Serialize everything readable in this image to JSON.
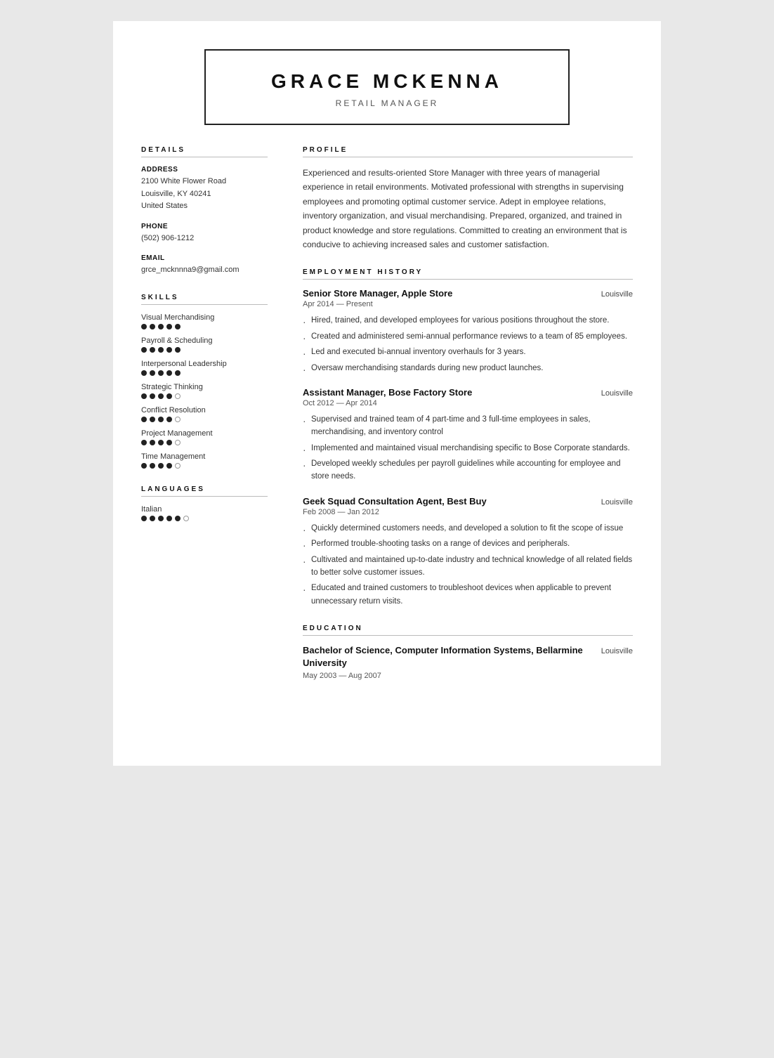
{
  "header": {
    "name": "GRACE MCKENNA",
    "title": "RETAIL MANAGER"
  },
  "details": {
    "section_title": "DETAILS",
    "address_label": "ADDRESS",
    "address_lines": [
      "2100 White Flower Road",
      "Louisville, KY 40241",
      "United States"
    ],
    "phone_label": "PHONE",
    "phone": "(502) 906-1212",
    "email_label": "EMAIL",
    "email": "grce_mcknnna9@gmail.com"
  },
  "skills": {
    "section_title": "SKILLS",
    "items": [
      {
        "name": "Visual Merchandising",
        "filled": 5,
        "empty": 0
      },
      {
        "name": "Payroll & Scheduling",
        "filled": 5,
        "empty": 0
      },
      {
        "name": "Interpersonal Leadership",
        "filled": 5,
        "empty": 0
      },
      {
        "name": "Strategic Thinking",
        "filled": 4,
        "empty": 1
      },
      {
        "name": "Conflict Resolution",
        "filled": 4,
        "empty": 1
      },
      {
        "name": "Project Management",
        "filled": 4,
        "empty": 1
      },
      {
        "name": "Time Management",
        "filled": 4,
        "empty": 1
      }
    ]
  },
  "languages": {
    "section_title": "LANGUAGES",
    "items": [
      {
        "name": "Italian",
        "filled": 5,
        "empty": 1
      }
    ]
  },
  "profile": {
    "section_title": "PROFILE",
    "text": "Experienced and results-oriented Store Manager with three years of managerial experience in retail environments. Motivated professional with strengths in supervising employees and promoting optimal customer service. Adept in employee relations, inventory organization, and visual merchandising. Prepared, organized, and trained in product knowledge and store regulations. Committed to creating an environment that is conducive to achieving increased sales and customer satisfaction."
  },
  "employment": {
    "section_title": "EMPLOYMENT HISTORY",
    "jobs": [
      {
        "title": "Senior Store Manager, Apple Store",
        "location": "Louisville",
        "date": "Apr 2014 — Present",
        "bullets": [
          "Hired, trained, and developed employees for various positions throughout the store.",
          "Created and administered semi-annual performance reviews to a team of 85 employees.",
          "Led and executed bi-annual inventory overhauls for 3 years.",
          "Oversaw merchandising standards during new product launches."
        ]
      },
      {
        "title": "Assistant Manager, Bose Factory Store",
        "location": "Louisville",
        "date": "Oct 2012 — Apr 2014",
        "bullets": [
          "Supervised and trained team of 4 part-time and 3 full-time employees in sales, merchandising, and inventory control",
          "Implemented and maintained visual merchandising specific to Bose Corporate standards.",
          "Developed weekly schedules per payroll guidelines while accounting for employee and store needs."
        ]
      },
      {
        "title": "Geek Squad Consultation Agent, Best Buy",
        "location": "Louisville",
        "date": "Feb 2008 — Jan 2012",
        "bullets": [
          "Quickly determined customers needs, and developed a solution to fit the scope of issue",
          "Performed trouble-shooting tasks on a range of devices and peripherals.",
          "Cultivated and maintained up-to-date industry and technical knowledge of all related fields to better solve customer issues.",
          "Educated and trained customers to troubleshoot devices when applicable to prevent unnecessary return visits."
        ]
      }
    ]
  },
  "education": {
    "section_title": "EDUCATION",
    "items": [
      {
        "title": "Bachelor of Science, Computer Information Systems, Bellarmine University",
        "location": "Louisville",
        "date": "May 2003 — Aug 2007"
      }
    ]
  }
}
